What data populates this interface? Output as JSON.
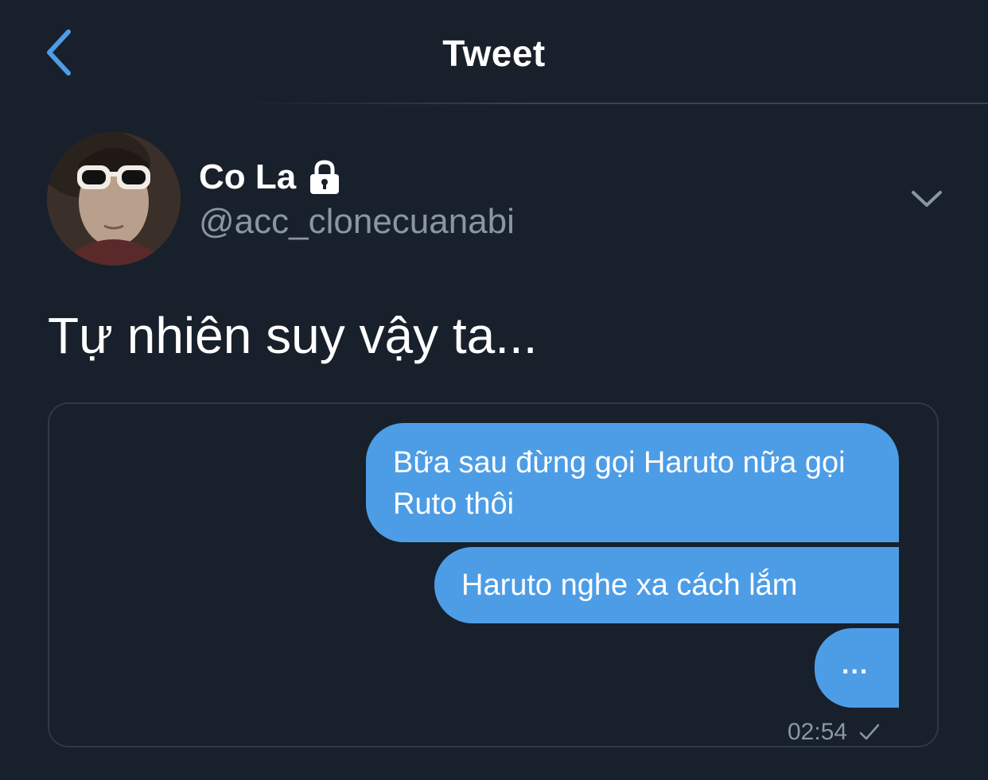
{
  "header": {
    "title": "Tweet",
    "back_icon": "chevron-left-icon"
  },
  "tweet": {
    "author": {
      "display_name": "Co La",
      "handle": "@acc_clonecuanabi",
      "protected_icon": "lock-icon"
    },
    "menu_icon": "chevron-down-icon",
    "text": "Tự nhiên suy vậy ta..."
  },
  "media": {
    "messages": [
      "Bữa sau đừng gọi Haruto nữa gọi Ruto thôi",
      "Haruto nghe xa cách lắm",
      "..."
    ],
    "timestamp": "02:54",
    "status_icon": "check-icon"
  },
  "colors": {
    "background": "#18202b",
    "accent": "#4d9de6",
    "secondary_text": "#8a96a3"
  }
}
